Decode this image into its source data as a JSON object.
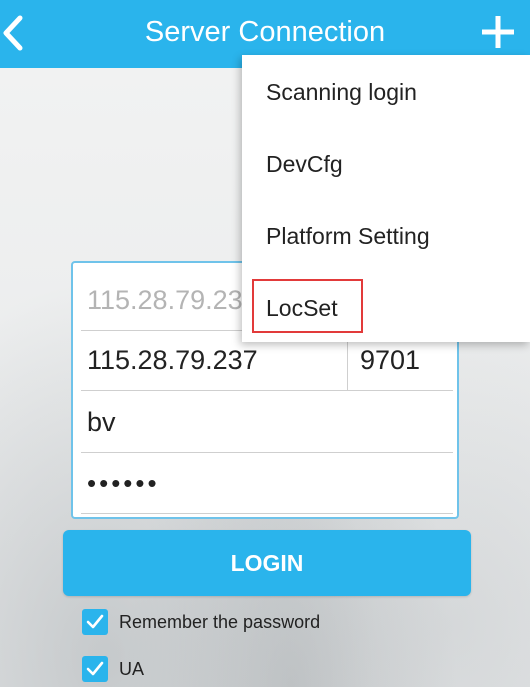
{
  "header": {
    "title": "Server Connection",
    "back_icon": "chevron-left-icon",
    "add_icon": "plus-icon"
  },
  "form": {
    "server_hint": "115.28.79.23",
    "server_address": "115.28.79.237",
    "port": "9701",
    "username": "bv",
    "password_mask": "••••••"
  },
  "login_button": {
    "label": "LOGIN"
  },
  "options": [
    {
      "label": "Remember the password",
      "checked": true
    },
    {
      "label": "UA",
      "checked": true
    }
  ],
  "menu": {
    "items": [
      {
        "label": "Scanning login"
      },
      {
        "label": "DevCfg"
      },
      {
        "label": "Platform Setting"
      },
      {
        "label": "LocSet"
      }
    ],
    "highlighted_item": "LocSet"
  },
  "colors": {
    "accent": "#2ab4ec",
    "highlight_border": "#e23a3a"
  }
}
